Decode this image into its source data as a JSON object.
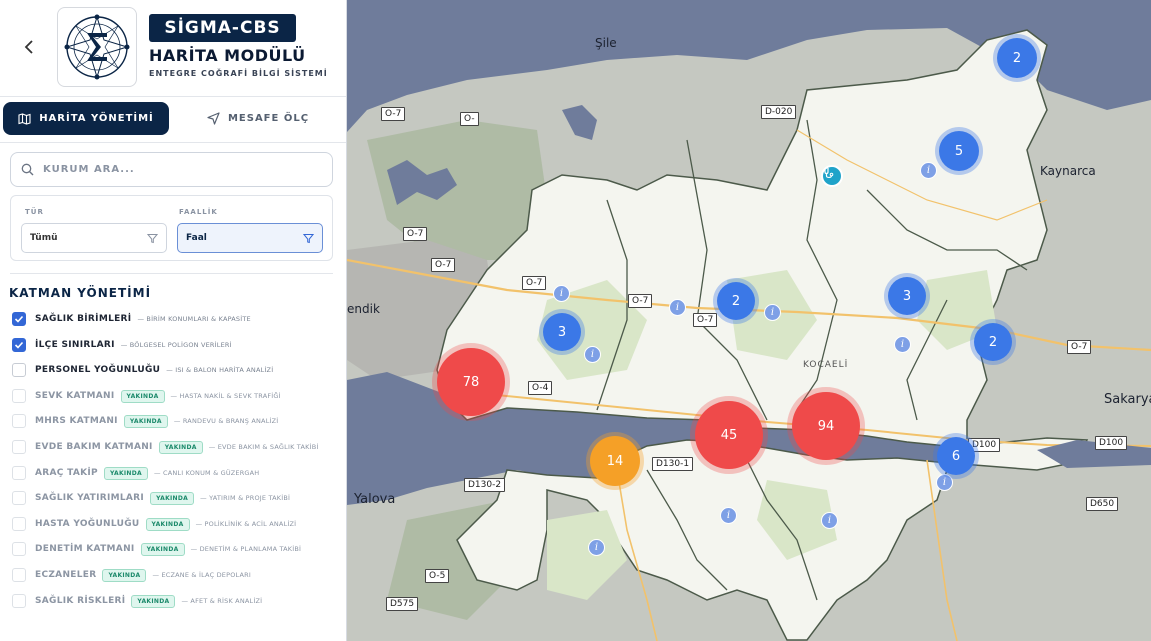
{
  "header": {
    "brand_badge": "SİGMA-CBS",
    "title": "HARİTA MODÜLÜ",
    "subtitle": "ENTEGRE COĞRAFİ BİLGİ SİSTEMİ"
  },
  "tabs": [
    {
      "label": "HARİTA YÖNETİMİ",
      "icon": "map-icon",
      "active": true
    },
    {
      "label": "MESAFE ÖLÇ",
      "icon": "navigation-arrow-icon",
      "active": false
    }
  ],
  "search": {
    "placeholder": "KURUM ARA...",
    "value": ""
  },
  "filters": {
    "type": {
      "label": "TÜR",
      "value": "Tümü"
    },
    "activity": {
      "label": "FAALLİK",
      "value": "Faal"
    }
  },
  "layers": {
    "title": "KATMAN YÖNETİMİ",
    "badge_label": "YAKINDA",
    "items": [
      {
        "name": "SAĞLIK BİRİMLERİ",
        "desc": "— BİRİM KONUMLARI & KAPASİTE",
        "checked": true,
        "soon": false
      },
      {
        "name": "İLÇE SINIRLARI",
        "desc": "— BÖLGESEL POLİGON VERİLERİ",
        "checked": true,
        "soon": false
      },
      {
        "name": "PERSONEL YOĞUNLUĞU",
        "desc": "— ISI & BALON HARİTA ANALİZİ",
        "checked": false,
        "soon": false
      },
      {
        "name": "SEVK KATMANI",
        "desc": "— HASTA NAKİL & SEVK TRAFİĞİ",
        "checked": false,
        "soon": true
      },
      {
        "name": "MHRS KATMANI",
        "desc": "— RANDEVU & BRANŞ ANALİZİ",
        "checked": false,
        "soon": true
      },
      {
        "name": "EVDE BAKIM KATMANI",
        "desc": "— EVDE BAKIM & SAĞLIK TAKİBİ",
        "checked": false,
        "soon": true
      },
      {
        "name": "ARAÇ TAKİP",
        "desc": "— CANLI KONUM & GÜZERGAH",
        "checked": false,
        "soon": true
      },
      {
        "name": "SAĞLIK YATIRIMLARI",
        "desc": "— YATIRIM & PROJE TAKİBİ",
        "checked": false,
        "soon": true
      },
      {
        "name": "HASTA YOĞUNLUĞU",
        "desc": "— POLİKLİNİK & ACİL ANALİZİ",
        "checked": false,
        "soon": true
      },
      {
        "name": "DENETİM KATMANI",
        "desc": "— DENETİM & PLANLAMA TAKİBİ",
        "checked": false,
        "soon": true
      },
      {
        "name": "ECZANELER",
        "desc": "— ECZANE & İLAÇ DEPOLARI",
        "checked": false,
        "soon": true
      },
      {
        "name": "SAĞLIK RİSKLERİ",
        "desc": "— AFET & RİSK ANALİZİ",
        "checked": false,
        "soon": true
      }
    ]
  },
  "map": {
    "colors": {
      "cluster_large": "#ef4a4a",
      "cluster_medium": "#f5a027",
      "cluster_small": "#3b78e7",
      "sea": "#6f7c9b",
      "district": "#f3f5ee"
    },
    "place_labels": [
      "Şile",
      "Kaynarca",
      "Sakarya",
      "Yalova",
      "KOCAELİ",
      "endik"
    ],
    "road_labels": [
      "O-7",
      "O-",
      "D-020",
      "O-7",
      "O-7",
      "O-7",
      "O-7",
      "O-7",
      "O-4",
      "O-7",
      "D100",
      "D100",
      "D130-1",
      "D130-2",
      "D650",
      "O-5",
      "D575"
    ],
    "clusters": [
      "2",
      "5",
      "2",
      "3",
      "3",
      "2",
      "78",
      "45",
      "94",
      "14",
      "6"
    ]
  }
}
